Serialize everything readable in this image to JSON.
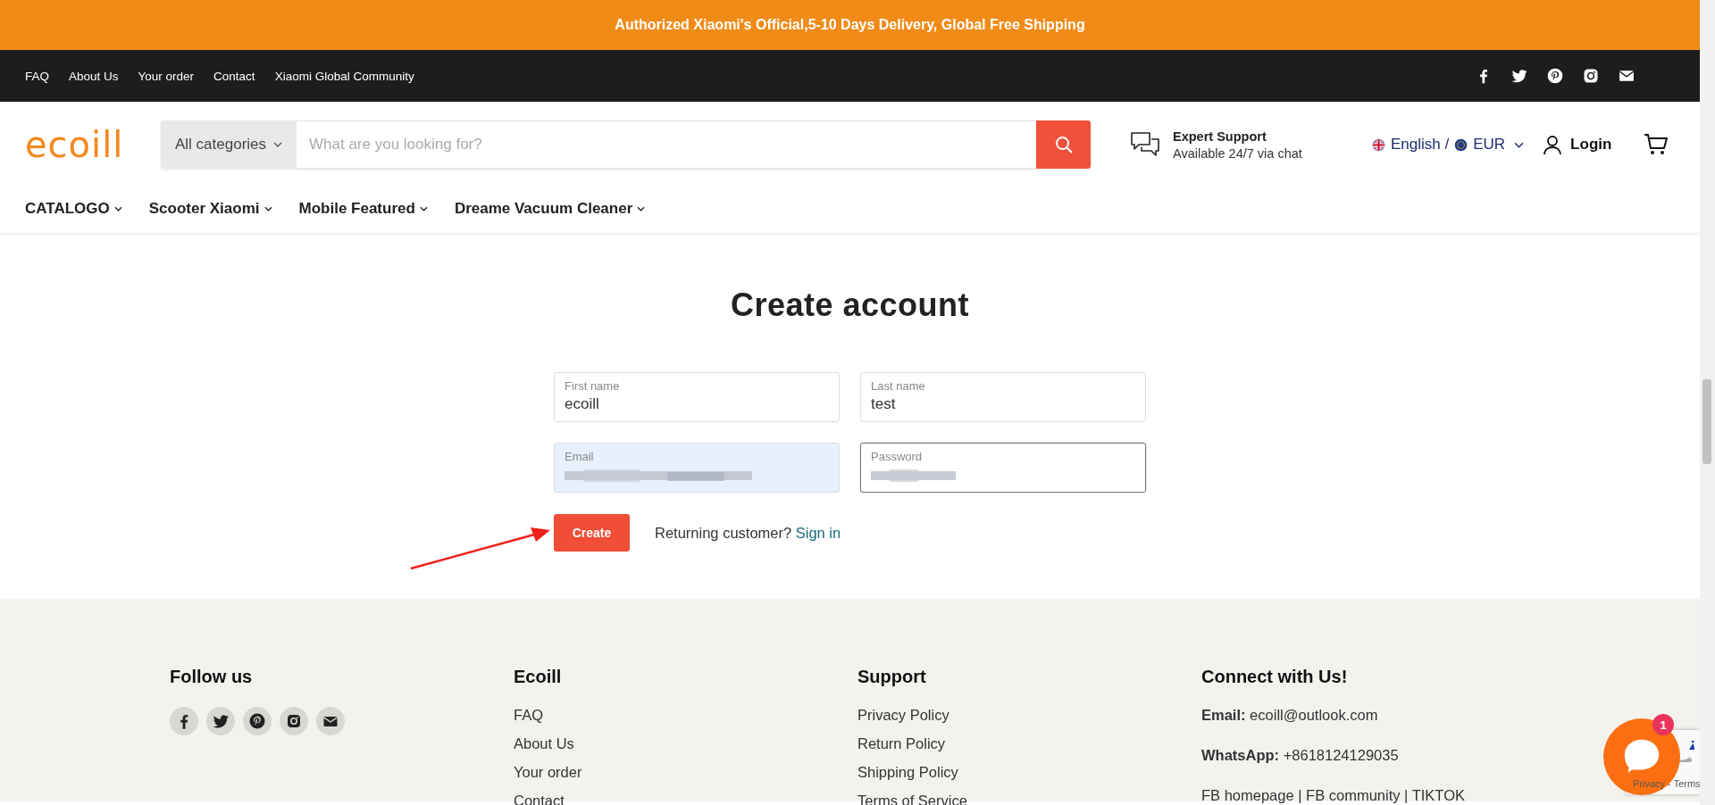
{
  "announcement": "Authorized Xiaomi's Official,5-10 Days Delivery, Global Free Shipping",
  "top_links": [
    "FAQ",
    "About Us",
    "Your order",
    "Contact",
    "Xiaomi Global Community"
  ],
  "top_social": [
    {
      "kind": "facebook"
    },
    {
      "kind": "twitter"
    },
    {
      "kind": "pinterest"
    },
    {
      "kind": "instagram"
    },
    {
      "kind": "email"
    }
  ],
  "logo": "ecoill",
  "search": {
    "category": "All categories",
    "placeholder": "What are you looking for?"
  },
  "support": {
    "title": "Expert Support",
    "subtitle": "Available 24/7 via chat"
  },
  "locale": {
    "language": "English /",
    "currency": "EUR"
  },
  "login": "Login",
  "nav": [
    "CATALOGO",
    "Scooter Xiaomi",
    "Mobile Featured",
    "Dreame Vacuum Cleaner"
  ],
  "page_title": "Create account",
  "fields": [
    {
      "label": "First name",
      "kind": "text",
      "value": "ecoill",
      "focused": false,
      "autofilled": false
    },
    {
      "label": "Last name",
      "kind": "text",
      "value": "test",
      "focused": false,
      "autofilled": false
    },
    {
      "label": "Email",
      "kind": "blurred",
      "focused": false,
      "autofilled": true
    },
    {
      "label": "Password",
      "kind": "blurred",
      "focused": true,
      "autofilled": false
    }
  ],
  "create_button": "Create",
  "returning": {
    "text": "Returning customer?",
    "link": "Sign in"
  },
  "footer": {
    "follow": {
      "title": "Follow us",
      "icons": [
        {
          "kind": "facebook"
        },
        {
          "kind": "twitter"
        },
        {
          "kind": "pinterest"
        },
        {
          "kind": "instagram"
        },
        {
          "kind": "email"
        }
      ]
    },
    "columns": [
      {
        "title": "Ecoill",
        "links": [
          "FAQ",
          "About Us",
          "Your order",
          "Contact"
        ]
      },
      {
        "title": "Support",
        "links": [
          "Privacy Policy",
          "Return Policy",
          "Shipping Policy",
          "Terms of Service"
        ]
      }
    ],
    "connect": {
      "title": "Connect with Us!",
      "lines": [
        "**Email:** ecoill@outlook.com",
        "**WhatsApp:** +8618124129035",
        "FB homepage | FB community | TIKTOK"
      ]
    }
  },
  "chat": {
    "badge": "1"
  },
  "recaptcha": "Privacy - Terms"
}
